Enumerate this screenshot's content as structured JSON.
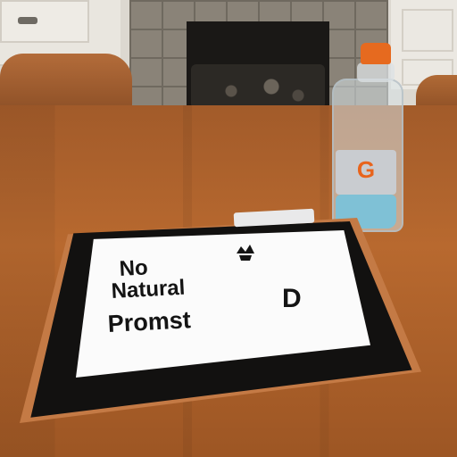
{
  "screen": {
    "line1": "No",
    "line2": "Natural",
    "line3": "Promst",
    "side_glyph": "D"
  },
  "bottle": {
    "label_letter": "G",
    "cap_color": "#e66a1f",
    "liquid_color": "#7fc1d6"
  },
  "colors": {
    "table": "#a25b2a",
    "tablet_frame": "#121110",
    "screen": "#fbfbfb"
  }
}
